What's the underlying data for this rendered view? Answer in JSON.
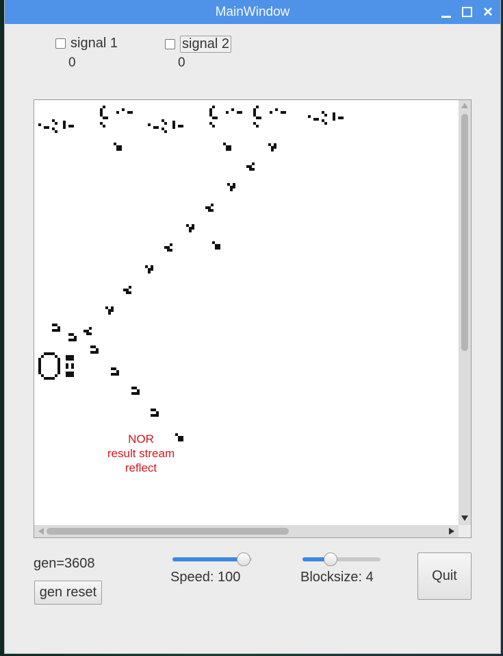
{
  "window": {
    "title": "MainWindow"
  },
  "signals": [
    {
      "label": "signal 1",
      "checked": false,
      "count": "0"
    },
    {
      "label": "signal 2",
      "checked": false,
      "count": "0"
    }
  ],
  "canvas": {
    "annotation": [
      "NOR",
      "result stream",
      "reflect"
    ],
    "annotation_color": "#d8151c"
  },
  "controls": {
    "gen_text": "gen=3608",
    "gen_reset_label": "gen reset",
    "speed_label": "Speed: 100",
    "speed_fraction": 0.9,
    "blocksize_label": "Blocksize: 4",
    "blocksize_fraction": 0.36,
    "quit_label": "Quit"
  },
  "icons": [
    "minimize-icon",
    "maximize-icon",
    "close-icon"
  ],
  "colors": {
    "titlebar": "#4f93e9",
    "slider_fill": "#3b88e4"
  }
}
